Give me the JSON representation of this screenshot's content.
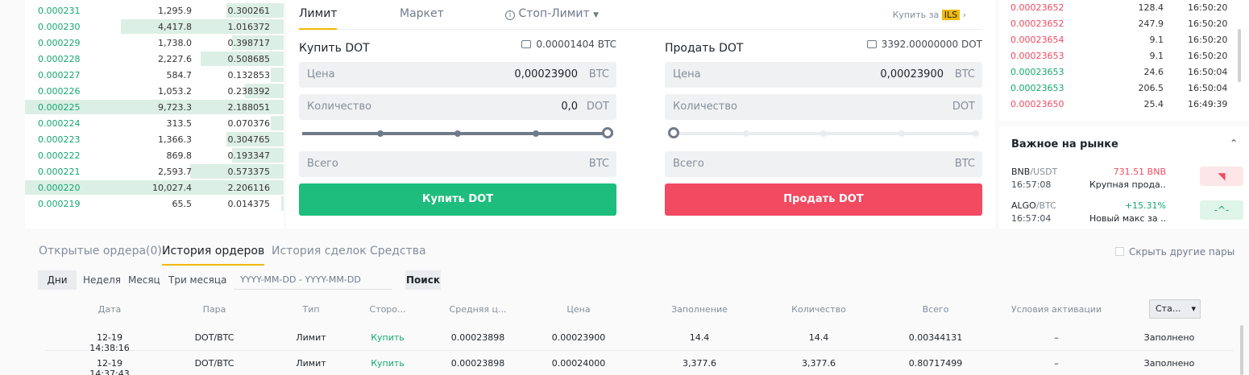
{
  "orderbook": {
    "rows": [
      {
        "price": "0.000231",
        "amount": "1,295.9",
        "total": "0.300261",
        "depth": 0.22
      },
      {
        "price": "0.000230",
        "amount": "4,417.8",
        "total": "1.016372",
        "depth": 0.63
      },
      {
        "price": "0.000229",
        "amount": "1,738.0",
        "total": "0.398717",
        "depth": 0.2
      },
      {
        "price": "0.000228",
        "amount": "2,227.6",
        "total": "0.508685",
        "depth": 0.32
      },
      {
        "price": "0.000227",
        "amount": "584.7",
        "total": "0.132853",
        "depth": 0.05
      },
      {
        "price": "0.000226",
        "amount": "1,053.2",
        "total": "0.238392",
        "depth": 0.15
      },
      {
        "price": "0.000225",
        "amount": "9,723.3",
        "total": "2.188051",
        "depth": 1.0
      },
      {
        "price": "0.000224",
        "amount": "313.5",
        "total": "0.070376",
        "depth": 0.05
      },
      {
        "price": "0.000223",
        "amount": "1,366.3",
        "total": "0.304765",
        "depth": 0.22
      },
      {
        "price": "0.000222",
        "amount": "869.8",
        "total": "0.193347",
        "depth": 0.2
      },
      {
        "price": "0.000221",
        "amount": "2,593.7",
        "total": "0.573375",
        "depth": 0.36
      },
      {
        "price": "0.000220",
        "amount": "10,027.4",
        "total": "2.206116",
        "depth": 1.0
      },
      {
        "price": "0.000219",
        "amount": "65.5",
        "total": "0.014375",
        "depth": 0.01
      }
    ]
  },
  "trade": {
    "tabs": [
      "Лимит",
      "Маркет",
      "Стоп-Лимит"
    ],
    "buy_for_label": "Купить за",
    "buy_for_currency": "ILS",
    "buy": {
      "title": "Купить DOT",
      "balance": "0.00001404 BTC",
      "price_label": "Цена",
      "price_value": "0,00023900",
      "price_unit": "BTC",
      "qty_label": "Количество",
      "qty_value": "0,0",
      "qty_unit": "DOT",
      "slider_level": 1.0,
      "total_label": "Всего",
      "total_unit": "BTC",
      "button": "Купить DOT"
    },
    "sell": {
      "title": "Продать DOT",
      "balance": "3392.00000000 DOT",
      "price_label": "Цена",
      "price_value": "0,00023900",
      "price_unit": "BTC",
      "qty_label": "Количество",
      "qty_unit": "DOT",
      "slider_level": 0,
      "total_label": "Всего",
      "total_unit": "BTC",
      "button": "Продать DOT"
    },
    "colors": {
      "buy": "#1ebd7d",
      "sell": "#f14a61",
      "accent": "#f0b90b"
    }
  },
  "recent_trades": [
    {
      "price": "0.00023652",
      "amount": "128.4",
      "time": "16:50:20",
      "side": "sell"
    },
    {
      "price": "0.00023652",
      "amount": "247.9",
      "time": "16:50:20",
      "side": "sell"
    },
    {
      "price": "0.00023654",
      "amount": "9.1",
      "time": "16:50:20",
      "side": "sell"
    },
    {
      "price": "0.00023653",
      "amount": "9.1",
      "time": "16:50:20",
      "side": "sell"
    },
    {
      "price": "0.00023653",
      "amount": "24.6",
      "time": "16:50:04",
      "side": "buy"
    },
    {
      "price": "0.00023653",
      "amount": "206.5",
      "time": "16:50:04",
      "side": "buy"
    },
    {
      "price": "0.00023650",
      "amount": "25.4",
      "time": "16:49:39",
      "side": "sell"
    }
  ],
  "market": {
    "title": "Важное на рынке",
    "items": [
      {
        "base": "BNB",
        "quote": "/USDT",
        "time": "16:57:08",
        "change": "731.51 BNB",
        "desc": "Крупная прода...",
        "icon": "whale-icon",
        "tone": "down"
      },
      {
        "base": "ALGO",
        "quote": "/BTC",
        "time": "16:57:04",
        "change": "+15.31%",
        "desc": "Новый макс за ...",
        "icon": "trend-icon",
        "tone": "up"
      }
    ]
  },
  "orders": {
    "tabs": [
      "Открытые ордера(0)",
      "История ордеров",
      "История сделок",
      "Средства"
    ],
    "hide_pairs": "Скрыть другие пары",
    "periods": [
      "Дни",
      "Неделя",
      "Месяц",
      "Три месяца"
    ],
    "date_placeholder": "YYYY-MM-DD - YYYY-MM-DD",
    "search": "Поиск",
    "headers": [
      "Дата",
      "Пара",
      "Тип",
      "Сторо...",
      "Средняя ц...",
      "Цена",
      "Заполнение",
      "Количество",
      "Всего",
      "Условия активации"
    ],
    "status_select": "Ста...",
    "rows": [
      {
        "date": "12-19 14:38:16",
        "pair": "DOT/BTC",
        "type": "Лимит",
        "side": "Купить",
        "avg": "0.00023898",
        "price": "0.00023900",
        "filled": "14.4",
        "qty": "14.4",
        "total": "0.00344131",
        "trigger": "–",
        "status": "Заполнено"
      },
      {
        "date": "12-19 14:37:43",
        "pair": "DOT/BTC",
        "type": "Лимит",
        "side": "Купить",
        "avg": "0.00023898",
        "price": "0.00024000",
        "filled": "3,377.6",
        "qty": "3,377.6",
        "total": "0.80717499",
        "trigger": "–",
        "status": "Заполнено"
      }
    ]
  }
}
